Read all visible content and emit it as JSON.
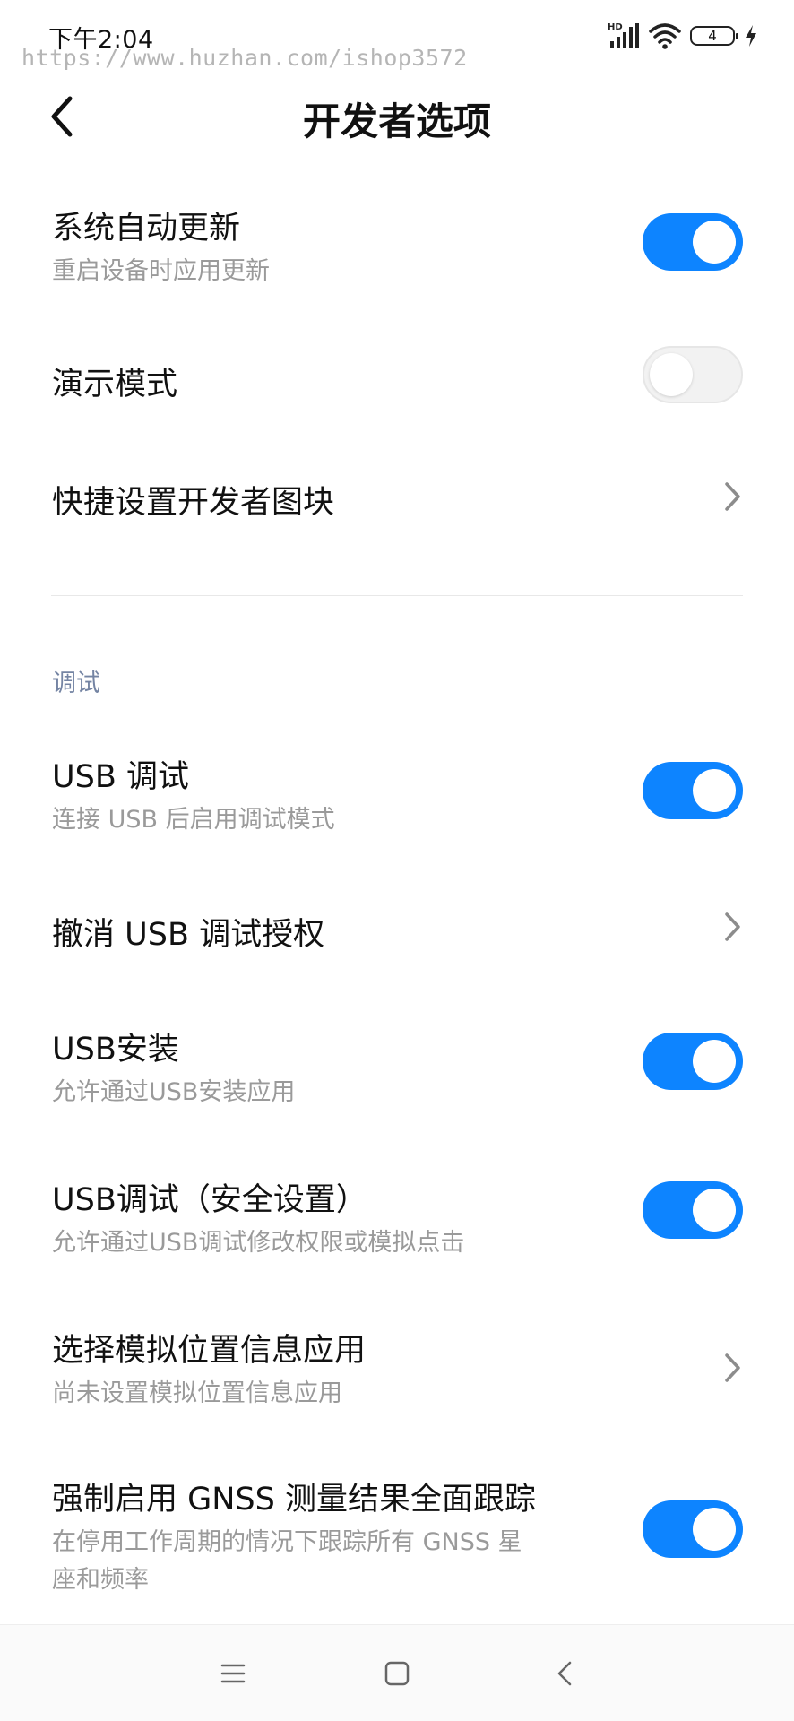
{
  "status_bar": {
    "time": "下午2:04",
    "watermark": "https://www.huzhan.com/ishop3572",
    "battery_level": "4",
    "signal_badge": "HD"
  },
  "header": {
    "title": "开发者选项"
  },
  "settings": {
    "auto_update": {
      "title": "系统自动更新",
      "subtitle": "重启设备时应用更新",
      "enabled": true
    },
    "demo_mode": {
      "title": "演示模式",
      "enabled": false
    },
    "quick_tiles": {
      "title": "快捷设置开发者图块"
    },
    "debug_section": {
      "label": "调试"
    },
    "usb_debugging": {
      "title": "USB 调试",
      "subtitle": "连接 USB 后启用调试模式",
      "enabled": true
    },
    "revoke_usb_auth": {
      "title": "撤消 USB 调试授权"
    },
    "usb_install": {
      "title": "USB安装",
      "subtitle": "允许通过USB安装应用",
      "enabled": true
    },
    "usb_debug_security": {
      "title": "USB调试（安全设置）",
      "subtitle": "允许通过USB调试修改权限或模拟点击",
      "enabled": true
    },
    "mock_location": {
      "title": "选择模拟位置信息应用",
      "subtitle": "尚未设置模拟位置信息应用"
    },
    "gnss_tracking": {
      "title": "强制启用 GNSS 测量结果全面跟踪",
      "subtitle_line1": "在停用工作周期的情况下跟踪所有 GNSS 星",
      "subtitle_line2": "座和频率",
      "enabled": true
    }
  },
  "colors": {
    "accent": "#0d84ff",
    "toggle_off": "#f2f2f2",
    "section_label": "#7484a3",
    "subtitle": "#9a9a9a"
  },
  "icons": {
    "back": "chevron-left-icon",
    "row_arrow": "chevron-right-icon",
    "nav_menu": "menu-icon",
    "nav_home": "square-home-icon",
    "nav_back": "triangle-back-icon"
  }
}
